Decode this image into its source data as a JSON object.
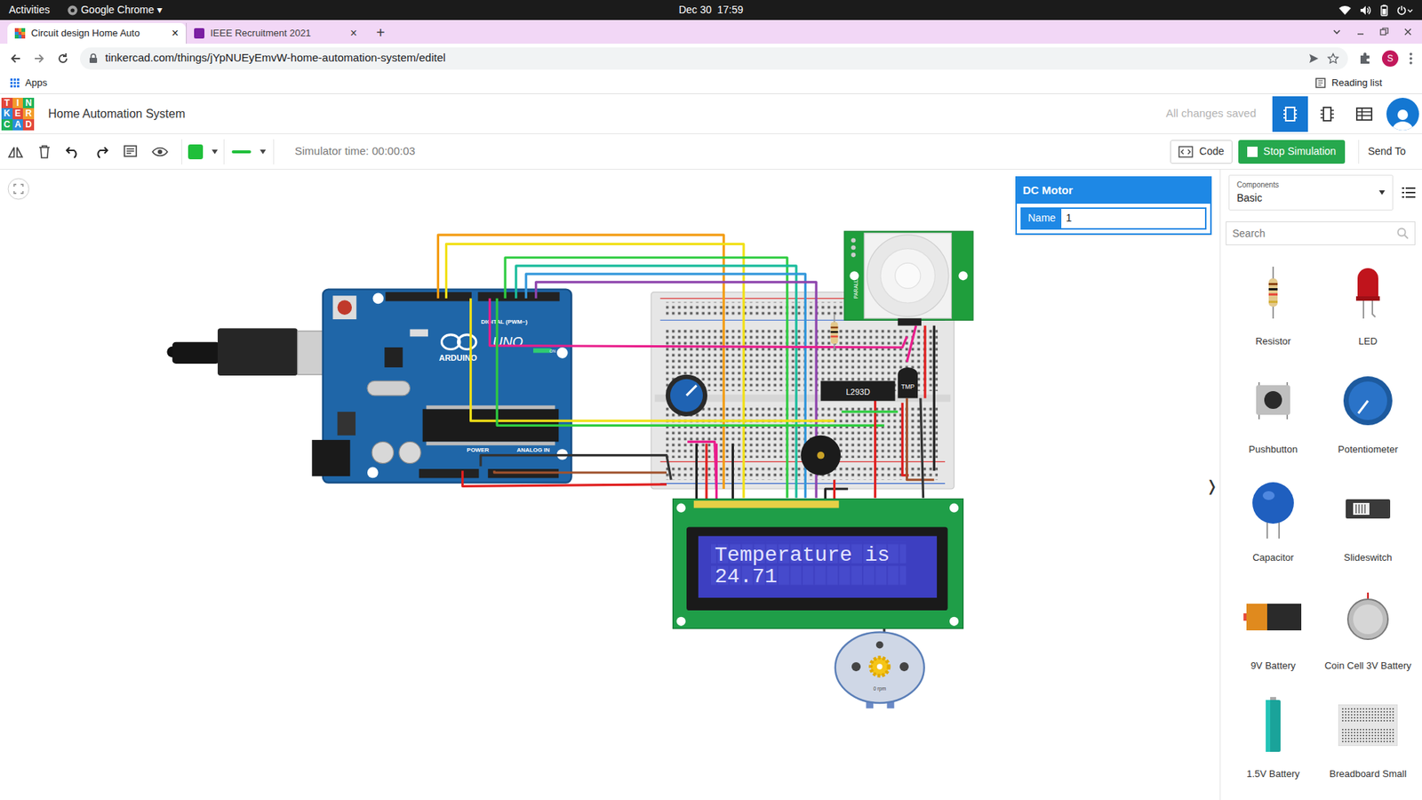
{
  "system_bar": {
    "activities": "Activities",
    "app": "Google Chrome",
    "app_arrow": "▾",
    "clock": "Dec 30  17:59"
  },
  "browser": {
    "tabs": [
      {
        "label": "Circuit design Home Auto",
        "close": "×",
        "selected": true
      },
      {
        "label": "IEEE Recruitment 2021",
        "close": "×",
        "selected": false
      }
    ],
    "new_tab": "+",
    "url": "tinkercad.com/things/jYpNUEyEmvW-home-automation-system/editel",
    "bookmarks": [
      {
        "label": "Apps"
      }
    ],
    "reading_list": "Reading list",
    "profile": "S"
  },
  "app": {
    "logo": [
      "T",
      "I",
      "N",
      "K",
      "E",
      "R",
      "C",
      "A",
      "D"
    ],
    "title": "Home Automation System",
    "save_status": "All changes saved",
    "views": [
      {
        "kind": "circuit",
        "selected": true
      },
      {
        "kind": "schematic",
        "selected": false
      },
      {
        "kind": "list",
        "selected": false
      }
    ]
  },
  "toolbar": {
    "simulator_time": "Simulator time: 00:00:03",
    "code": "Code",
    "stop": "Stop Simulation",
    "send_to": "Send To"
  },
  "inspector": {
    "title": "DC Motor",
    "name_label": "Name",
    "name_value": "1"
  },
  "circuit": {
    "arduino": {
      "brand": "ARDUINO",
      "model": "UNO",
      "digital": "DIGITAL (PWM~)",
      "power": "POWER",
      "analog": "ANALOG IN",
      "on": "ON"
    },
    "driver": "L293D",
    "sensor": "TMP",
    "pir": "PARALLAX",
    "lcd": {
      "line1": "Temperature is",
      "line2": "24.71"
    },
    "motor": {
      "speed": "0 rpm"
    }
  },
  "collapse_arrow": "❭",
  "components": {
    "label": "Components",
    "category": "Basic",
    "search_placeholder": "Search",
    "items": [
      {
        "label": "Resistor",
        "kind": "resistor"
      },
      {
        "label": "LED",
        "kind": "led"
      },
      {
        "label": "Pushbutton",
        "kind": "pushbutton"
      },
      {
        "label": "Potentiometer",
        "kind": "potentiometer"
      },
      {
        "label": "Capacitor",
        "kind": "capacitor"
      },
      {
        "label": "Slideswitch",
        "kind": "slideswitch"
      },
      {
        "label": "9V Battery",
        "kind": "battery9v"
      },
      {
        "label": "Coin Cell 3V Battery",
        "kind": "coincell"
      },
      {
        "label": "1.5V Battery",
        "kind": "battery15"
      },
      {
        "label": "Breadboard Small",
        "kind": "breadboard"
      }
    ]
  }
}
